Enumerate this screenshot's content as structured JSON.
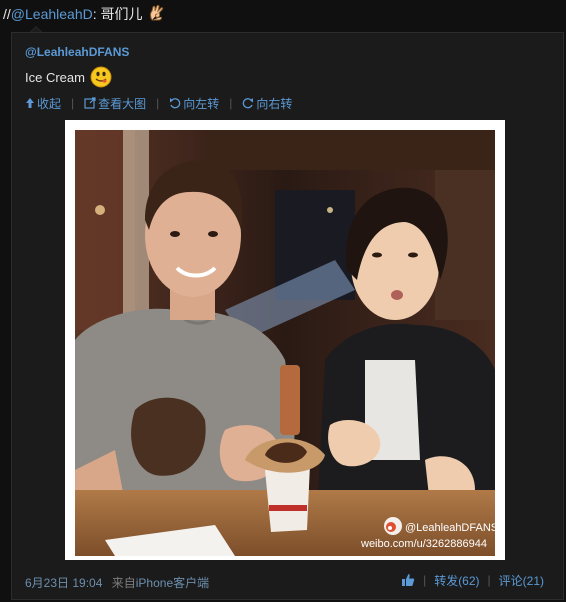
{
  "post": {
    "prefix": "//",
    "mention": "@LeahleahD",
    "colon_text": ": 哥们儿"
  },
  "original": {
    "author": "@LeahleahDFANS",
    "text": "Ice Cream"
  },
  "toolbar": {
    "collapse": "收起",
    "view_large": "查看大图",
    "rotate_left": "向左转",
    "rotate_right": "向右转"
  },
  "image": {
    "watermark_handle": "@LeahleahDFANS",
    "watermark_url": "weibo.com/u/3262886944"
  },
  "meta": {
    "date": "6月23日 19:04",
    "via_prefix": "来自",
    "via_source": "iPhone客户端"
  },
  "actions": {
    "repost": "转发(62)",
    "comment": "评论(21)"
  },
  "colors": {
    "link": "#5b9ad6",
    "background": "#101010",
    "panel": "#1b1b1b"
  }
}
